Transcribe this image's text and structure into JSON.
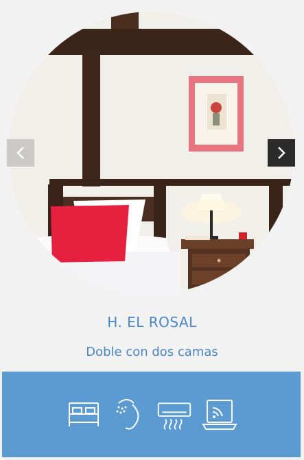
{
  "colors": {
    "accent": "#5b9bd1",
    "title": "#4a86c5",
    "background": "#f2f2f2",
    "icon_stroke": "#ffffff"
  },
  "slider": {
    "prev_icon": "chevron-left-icon",
    "next_icon": "chevron-right-icon"
  },
  "room": {
    "name": "H. EL ROSAL",
    "type": "Doble con dos camas"
  },
  "amenities": [
    {
      "icon": "bed-icon"
    },
    {
      "icon": "shower-icon"
    },
    {
      "icon": "air-conditioning-icon"
    },
    {
      "icon": "wifi-laptop-icon"
    }
  ]
}
